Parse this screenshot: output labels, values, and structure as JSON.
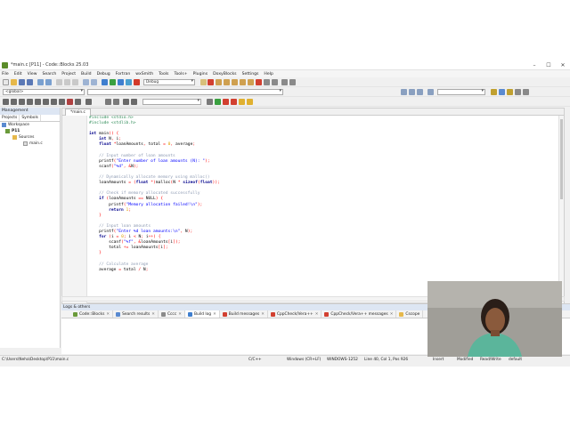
{
  "window": {
    "title": "*main.c [P11] - Code::Blocks 25.03",
    "controls": [
      "–",
      "☐",
      "✕"
    ]
  },
  "menu": [
    "File",
    "Edit",
    "View",
    "Search",
    "Project",
    "Build",
    "Debug",
    "Fortran",
    "wxSmith",
    "Tools",
    "Tools+",
    "Plugins",
    "DoxyBlocks",
    "Settings",
    "Help"
  ],
  "toolbar": {
    "build_target": "Debug",
    "scope": "<global>"
  },
  "management": {
    "title": "Management",
    "tabs": [
      "Projects",
      "Symbols"
    ],
    "tree": {
      "workspace": "Workspace",
      "project": "P11",
      "folder": "Sources",
      "file": "main.c"
    }
  },
  "editor": {
    "tab": "*main.c",
    "lines": [
      {
        "n": "1",
        "text": "#include <stdio.h>"
      },
      {
        "n": "2",
        "text": "#include <stdlib.h>"
      },
      {
        "n": "3",
        "text": ""
      },
      {
        "n": "4",
        "text": "int main() {"
      },
      {
        "n": "5",
        "text": "    int N, i;"
      },
      {
        "n": "6",
        "text": "    float *loanAmounts, total = 0, average;"
      },
      {
        "n": "7",
        "text": ""
      },
      {
        "n": "8",
        "text": "    // Input number of loan amounts"
      },
      {
        "n": "9",
        "text": "    printf(\"Enter number of loan amounts (N): \");"
      },
      {
        "n": "10",
        "text": "    scanf(\"%d\", &N);"
      },
      {
        "n": "11",
        "text": ""
      },
      {
        "n": "12",
        "text": "    // Dynamically allocate memory using malloc()"
      },
      {
        "n": "13",
        "text": "    loanAmounts = (float *)malloc(N * sizeof(float));"
      },
      {
        "n": "14",
        "text": ""
      },
      {
        "n": "15",
        "text": "    // Check if memory allocated successfully"
      },
      {
        "n": "16",
        "text": "    if (loanAmounts == NULL) {"
      },
      {
        "n": "17",
        "text": "        printf(\"Memory allocation failed!\\n\");"
      },
      {
        "n": "18",
        "text": "        return 1;"
      },
      {
        "n": "19",
        "text": "    }"
      },
      {
        "n": "20",
        "text": ""
      },
      {
        "n": "21",
        "text": "    // Input loan amounts"
      },
      {
        "n": "22",
        "text": "    printf(\"Enter %d loan amounts:\\n\", N);"
      },
      {
        "n": "23",
        "text": "    for (i = 0; i < N; i++) {"
      },
      {
        "n": "24",
        "text": "        scanf(\"%f\", &loanAmounts[i]);"
      },
      {
        "n": "25",
        "text": "        total += loanAmounts[i];"
      },
      {
        "n": "26",
        "text": "    }"
      },
      {
        "n": "27",
        "text": ""
      },
      {
        "n": "28",
        "text": "    // Calculate average"
      },
      {
        "n": "29",
        "text": "    average = total / N;"
      }
    ]
  },
  "logs": {
    "title": "Logs & others",
    "tabs": [
      "Code::Blocks",
      "Search results",
      "Cccc",
      "Build log",
      "Build messages",
      "CppCheck/Vera++",
      "CppCheck/Vera++ messages",
      "Cscope"
    ]
  },
  "status": {
    "path": "C:\\Users\\Neha\\Desktop\\P11\\main.c",
    "language": "C/C++",
    "eol": "Windows (CR+LF)",
    "encoding": "WINDOWS-1252",
    "position": "Line 40, Col 1, Pos 926",
    "mode": "Insert",
    "modified": "Modified",
    "access": "Read/Write",
    "profile": "default"
  },
  "colors": {
    "preprocessor": "#2e8b57",
    "keyword": "#00008b",
    "comment": "#8f9cb4",
    "string": "#0000ff",
    "number": "#e0a000",
    "operator": "#ff0000"
  }
}
